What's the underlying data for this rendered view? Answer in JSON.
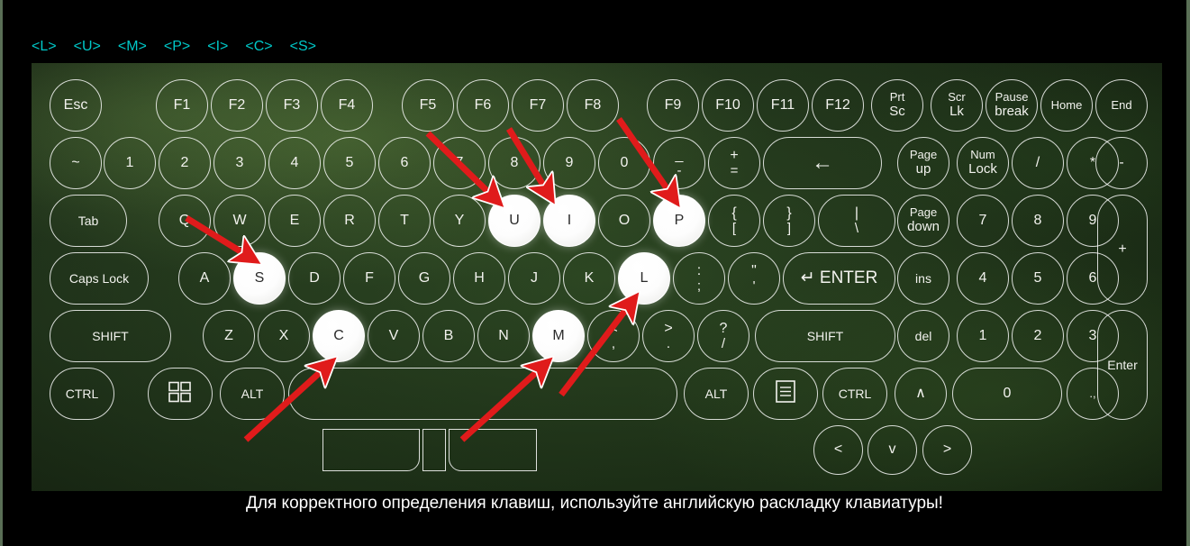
{
  "indicators": [
    {
      "label": "<L>"
    },
    {
      "label": "<U>"
    },
    {
      "label": "<M>"
    },
    {
      "label": "<P>"
    },
    {
      "label": "<I>"
    },
    {
      "label": "<C>"
    },
    {
      "label": "<S>"
    }
  ],
  "colors": {
    "indicator": "#00c8c8",
    "arrow": "#e01b1b",
    "key_border": "#ffffff",
    "key_text": "#f2f2ee",
    "highlight_fill": "#ffffff",
    "highlight_text": "#2b2b2b",
    "panel_green": "#2d4a22",
    "page_background": "#000000",
    "caption_text": "#ffffff"
  },
  "caption": {
    "text": "Для корректного определения клавиш, используйте английскую раскладку клавиатуры!"
  },
  "keyboard": {
    "highlighted_keys": [
      "U",
      "I",
      "P",
      "S",
      "L",
      "C",
      "M"
    ],
    "rows": {
      "function_row": [
        {
          "label": "Esc"
        },
        {
          "label": "F1"
        },
        {
          "label": "F2"
        },
        {
          "label": "F3"
        },
        {
          "label": "F4"
        },
        {
          "label": "F5"
        },
        {
          "label": "F6"
        },
        {
          "label": "F7"
        },
        {
          "label": "F8"
        },
        {
          "label": "F9"
        },
        {
          "label": "F10"
        },
        {
          "label": "F11"
        },
        {
          "label": "F12"
        },
        {
          "label": "Prt",
          "sub": "Sc"
        },
        {
          "label": "Scr",
          "sub": "Lk"
        },
        {
          "label": "Pause",
          "sub": "break"
        },
        {
          "label": "Home"
        },
        {
          "label": "End"
        }
      ],
      "number_row": [
        {
          "label": "~"
        },
        {
          "label": "1"
        },
        {
          "label": "2"
        },
        {
          "label": "3"
        },
        {
          "label": "4"
        },
        {
          "label": "5"
        },
        {
          "label": "6"
        },
        {
          "label": "7"
        },
        {
          "label": "8"
        },
        {
          "label": "9"
        },
        {
          "label": "0"
        },
        {
          "label": "_",
          "sub": "-"
        },
        {
          "label": "+",
          "sub": "="
        },
        {
          "label": "←"
        },
        {
          "label": "Page",
          "sub": "up"
        },
        {
          "label": "Num",
          "sub": "Lock"
        },
        {
          "label": "/"
        },
        {
          "label": "*"
        },
        {
          "label": "-"
        }
      ],
      "top_row": [
        {
          "label": "Tab"
        },
        {
          "label": "Q"
        },
        {
          "label": "W"
        },
        {
          "label": "E"
        },
        {
          "label": "R"
        },
        {
          "label": "T"
        },
        {
          "label": "Y"
        },
        {
          "label": "U"
        },
        {
          "label": "I"
        },
        {
          "label": "O"
        },
        {
          "label": "P"
        },
        {
          "label": "{",
          "sub": "["
        },
        {
          "label": "}",
          "sub": "]"
        },
        {
          "label": "|",
          "sub": "\\"
        },
        {
          "label": "Page",
          "sub": "down"
        },
        {
          "label": "7"
        },
        {
          "label": "8"
        },
        {
          "label": "9"
        },
        {
          "label": "+"
        }
      ],
      "home_row": [
        {
          "label": "Caps Lock"
        },
        {
          "label": "A"
        },
        {
          "label": "S"
        },
        {
          "label": "D"
        },
        {
          "label": "F"
        },
        {
          "label": "G"
        },
        {
          "label": "H"
        },
        {
          "label": "J"
        },
        {
          "label": "K"
        },
        {
          "label": "L"
        },
        {
          "label": ":",
          "sub": ";"
        },
        {
          "label": "\"",
          "sub": "'"
        },
        {
          "label": "↵ ENTER"
        },
        {
          "label": "ins"
        },
        {
          "label": "4"
        },
        {
          "label": "5"
        },
        {
          "label": "6"
        },
        {
          "label": "Enter"
        }
      ],
      "bottom_row": [
        {
          "label": "SHIFT"
        },
        {
          "label": "Z"
        },
        {
          "label": "X"
        },
        {
          "label": "C"
        },
        {
          "label": "V"
        },
        {
          "label": "B"
        },
        {
          "label": "N"
        },
        {
          "label": "M"
        },
        {
          "label": "<",
          "sub": ","
        },
        {
          "label": ">",
          "sub": "."
        },
        {
          "label": "?",
          "sub": "/"
        },
        {
          "label": "SHIFT"
        },
        {
          "label": "del"
        },
        {
          "label": "1"
        },
        {
          "label": "2"
        },
        {
          "label": "3"
        }
      ],
      "modifier_row": [
        {
          "label": "CTRL"
        },
        {
          "label": "win-logo"
        },
        {
          "label": "ALT"
        },
        {
          "label": "space"
        },
        {
          "label": "ALT"
        },
        {
          "label": "menu-icon"
        },
        {
          "label": "CTRL"
        },
        {
          "label": "∧"
        },
        {
          "label": "0"
        },
        {
          "label": ".,"
        }
      ],
      "arrow_cluster": [
        {
          "label": "<"
        },
        {
          "label": "v"
        },
        {
          "label": ">"
        }
      ]
    }
  }
}
